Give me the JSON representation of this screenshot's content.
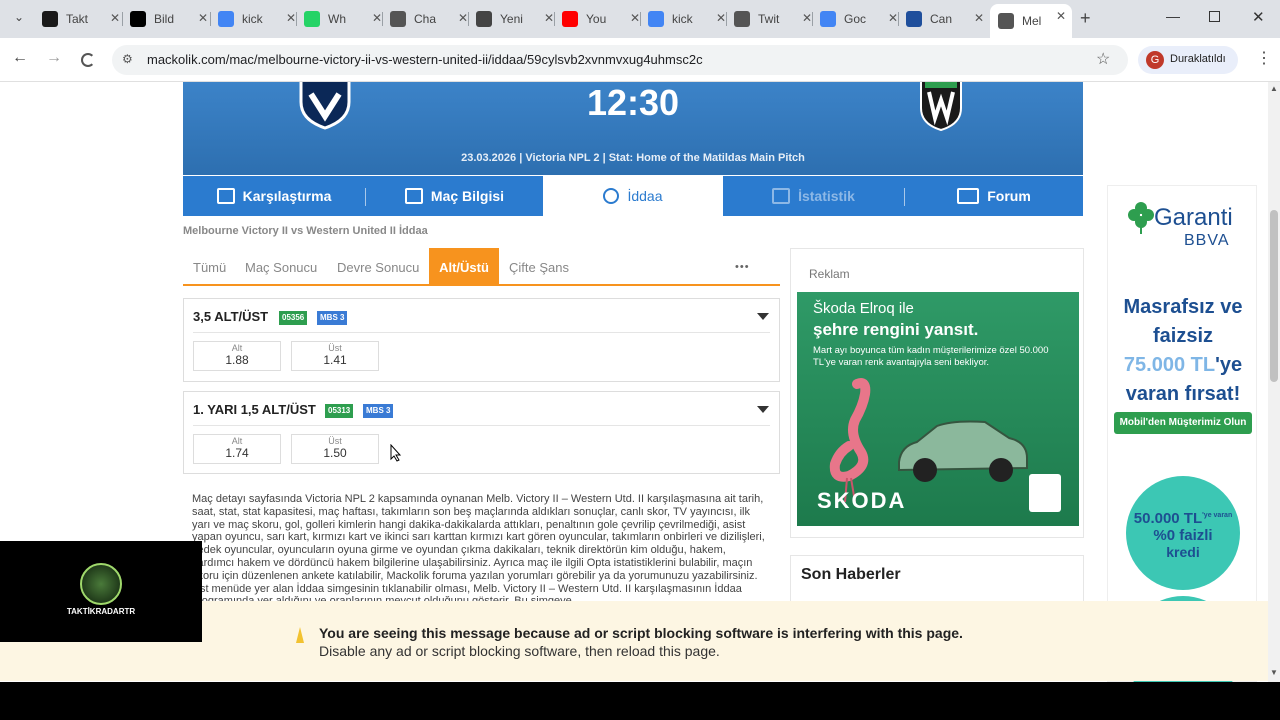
{
  "browser": {
    "tabs": [
      {
        "title": "Takt",
        "icon": "k-logo-icon",
        "color": "#1a1a1a"
      },
      {
        "title": "Bild",
        "icon": "x-logo-icon",
        "color": "#000000"
      },
      {
        "title": "kick",
        "icon": "google-icon",
        "color": "#4285f4"
      },
      {
        "title": "Wh",
        "icon": "whatsapp-icon",
        "color": "#25d366"
      },
      {
        "title": "Cha",
        "icon": "chatgpt-icon",
        "color": "#555555"
      },
      {
        "title": "Yeni",
        "icon": "chrome-icon",
        "color": "#444444"
      },
      {
        "title": "You",
        "icon": "youtube-icon",
        "color": "#ff0000"
      },
      {
        "title": "kick",
        "icon": "google-icon",
        "color": "#4285f4"
      },
      {
        "title": "Twit",
        "icon": "globe-icon",
        "color": "#555555"
      },
      {
        "title": "Goc",
        "icon": "google-icon",
        "color": "#4285f4"
      },
      {
        "title": "Can",
        "icon": "m-logo-icon",
        "color": "#1f4f9c"
      },
      {
        "title": "Mel",
        "icon": "globe-icon",
        "color": "#555555",
        "active": true
      }
    ],
    "url": "mackolik.com/mac/melbourne-victory-ii-vs-western-united-ii/iddaa/59cylsvb2xvnmvxug4uhmsc2c",
    "profile_label": "Duraklatıldı",
    "profile_initial": "G"
  },
  "match": {
    "time": "12:30",
    "info": "23.03.2026 | Victoria NPL 2 | Stat: Home of the Matildas Main Pitch"
  },
  "nav": [
    {
      "label": "Karşılaştırma"
    },
    {
      "label": "Maç Bilgisi"
    },
    {
      "label": "İddaa",
      "active": true
    },
    {
      "label": "İstatistik",
      "disabled": true
    },
    {
      "label": "Forum"
    }
  ],
  "breadcrumb": "Melbourne Victory II vs Western United II İddaa",
  "bet_tabs": [
    "Tümü",
    "Maç Sonucu",
    "Devre Sonucu",
    "Alt/Üstü",
    "Çifte Şans"
  ],
  "bet_tabs_more": "•••",
  "markets": [
    {
      "title": "3,5 ALT/ÜST",
      "code": "05356",
      "mbs": "MBS 3",
      "odds": [
        {
          "label": "Alt",
          "value": "1.88"
        },
        {
          "label": "Üst",
          "value": "1.41"
        }
      ]
    },
    {
      "title": "1. YARI 1,5 ALT/ÜST",
      "code": "05313",
      "mbs": "MBS 3",
      "odds": [
        {
          "label": "Alt",
          "value": "1.74"
        },
        {
          "label": "Üst",
          "value": "1.50"
        }
      ]
    }
  ],
  "description": "Maç detayı sayfasında Victoria NPL 2 kapsamında oynanan Melb. Victory II – Western Utd. II karşılaşmasına ait tarih, saat, stat, stat kapasitesi, maç haftası, takımların son beş maçlarında aldıkları sonuçlar, canlı skor, TV yayıncısı, ilk yarı ve maç skoru, gol, golleri kimlerin hangi dakika-dakikalarda attıkları, penaltının gole çevrilip çevrilmediği, asist yapan oyuncu, sarı kart, kırmızı kart ve ikinci sarı karttan kırmızı kart gören oyuncular, takımların onbirleri ve dizilişleri, yedek oyuncular, oyuncuların oyuna girme ve oyundan çıkma dakikaları, teknik direktörün kim olduğu, hakem, yardımcı hakem ve dördüncü hakem bilgilerine ulaşabilirsiniz. Ayrıca maç ile ilgili Opta istatistiklerini bulabilir, maçın skoru için düzenlenen ankete katılabilir, Mackolik foruma yazılan yorumları görebilir ya da yorumunuzu yazabilirsiniz. Üst menüde yer alan İddaa simgesinin tıklanabilir olması, Melb. Victory II – Western Utd. II karşılaşmasının İddaa programında yer aldığını ve oranlarının mevcut olduğunu gösterir. Bu simgeye",
  "ad": {
    "label": "Reklam",
    "skoda_line1": "Škoda Elroq ile",
    "skoda_line2": "şehre rengini yansıt.",
    "skoda_line3": "Mart ayı boyunca tüm kadın müşterilerimize özel 50.000 TL'ye varan renk avantajıyla seni bekliyor.",
    "skoda_brand": "SKODA"
  },
  "news_title": "Son Haberler",
  "garanti": {
    "brand1": "Garanti",
    "brand2": "BBVA",
    "headline1": "Masrafsız ve",
    "headline2": "faizsiz",
    "headline3": "75.000 TL",
    "headline3b": "'ye",
    "headline4": "varan fırsat!",
    "cta": "Mobil'den Müşterimiz Olun",
    "circle_amount": "50.000 TL",
    "circle_sup": "'ye varan",
    "circle_rate": "%0 faizli",
    "circle_credit": "kredi"
  },
  "adblock": {
    "line1": "You are seeing this message because ad or script blocking software is interfering with this page.",
    "line2": "Disable any ad or script blocking software, then reload this page."
  },
  "video_overlay_brand": "TAKTİKRADARTR",
  "colors": {
    "accent": "#f7931e",
    "nav_blue": "#2b7bcf",
    "mbs_blue": "#3a7bd5",
    "code_green": "#2e9e4f"
  }
}
